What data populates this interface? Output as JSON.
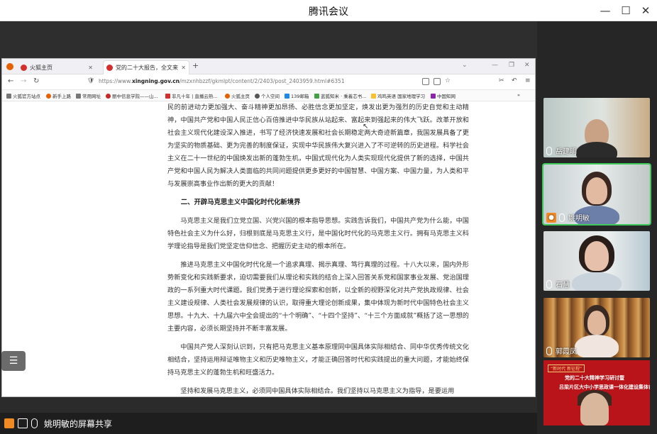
{
  "app": {
    "title": "腾讯会议",
    "share_label": "姚明敏的屏幕共享"
  },
  "browser": {
    "tabs": [
      {
        "label": "火狐主页"
      },
      {
        "label": "党的二十大报告，全文来了！"
      }
    ],
    "url_prefix": "https://www.",
    "url_domain": "xingning.gov.cn",
    "url_path": "/mzxnhbzzf/gkmlpt/content/2/2403/post_2403959.html#6351",
    "bookmarks": [
      "火狐官方站点",
      "新手上路",
      "常用网址",
      "丽中信息学院——山...",
      "非凡十年 | 直播云熟...",
      "火狐主页",
      "个人空间",
      "139邮箱",
      "蓝狐知米 · 乘着芯书...",
      "鸡鸣英语 国家地理学习",
      "中国知网"
    ]
  },
  "article": {
    "para0": "民的前进动力更加强大、奋斗精神更加昂扬、必胜信念更加坚定，焕发出更为强烈的历史自觉和主动精神，中国共产党和中国人民正信心百倍推进中华民族从站起来、富起来到强起来的伟大飞跃。改革开放和社会主义现代化建设深入推进，书写了经济快速发展和社会长期稳定两大奇迹新篇章，我国发展具备了更为坚实的物质基础、更为完善的制度保证，实现中华民族伟大复兴进入了不可逆转的历史进程。科学社会主义在二十一世纪的中国焕发出新的蓬勃生机，中国式现代化为人类实现现代化提供了新的选择，中国共产党和中国人民为解决人类面临的共同问题提供更多更好的中国智慧、中国方案、中国力量，为人类和平与发展崇高事业作出新的更大的贡献！",
    "heading": "二、开辟马克思主义中国化时代化新境界",
    "para1": "马克思主义是我们立党立国、兴党兴国的根本指导思想。实践告诉我们，中国共产党为什么能，中国特色社会主义为什么好，归根到底是马克思主义行，是中国化时代化的马克思主义行。拥有马克思主义科学理论指导是我们党坚定信仰信念、把握历史主动的根本所在。",
    "para2": "推进马克思主义中国化时代化是一个追求真理、揭示真理、笃行真理的过程。十八大以来，国内外形势新变化和实践新要求，迫切需要我们从理论和实践的结合上深入回答关系党和国家事业发展、党治国理政的一系列重大时代课题。我们党勇于进行理论探索和创新，以全新的视野深化对共产党执政规律、社会主义建设规律、人类社会发展规律的认识，取得重大理论创新成果，集中体现为新时代中国特色社会主义思想。十九大、十九届六中全会提出的“十个明确”、“十四个坚持”、“十三个方面成就”概括了这一思想的主要内容，必须长期坚持并不断丰富发展。",
    "para3": "中国共产党人深刻认识到，只有把马克思主义基本原理同中国具体实际相结合、同中华优秀传统文化相结合，坚持运用辩证唯物主义和历史唯物主义，才能正确回答时代和实践提出的重大问题，才能始终保持马克思主义的蓬勃生机和旺盛活力。",
    "para4": "坚持和发展马克思主义，必须同中国具体实际相结合。我们坚持以马克思主义为指导，是要运用"
  },
  "participants": [
    {
      "name": "岳建明"
    },
    {
      "name": "姚明敏"
    },
    {
      "name": "石慧"
    },
    {
      "name": "郭霞凤"
    }
  ],
  "poster": {
    "tag": "“新时代 新征程”",
    "line1": "党的二十大精神学习研讨暨",
    "line2": "吕梁片区大中小学思政课一体化建设集体备课会"
  },
  "colors": {
    "active_speaker": "#3ec95a",
    "user_icon": "#f08a24",
    "poster_bg": "#b8141a"
  }
}
